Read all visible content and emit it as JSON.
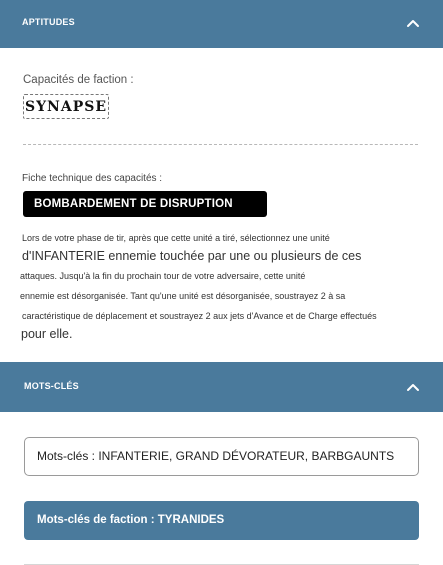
{
  "aptitudes": {
    "header": "APTITUDES",
    "faction_label": "Capacités de faction :",
    "faction_ability": "SYNAPSE",
    "tech_label": "Fiche technique des capacités :",
    "ability_name": "BOMBARDEMENT DE DISRUPTION",
    "ability_lines": [
      {
        "a": "Lors de votre phase de tir, après que cette unité a tiré, sélectionnez une unité",
        "b": ""
      },
      {
        "a": "",
        "b": "d'INFANTERIE ennemie touchée par une ou plusieurs de ces"
      },
      {
        "a": "attaques. Jusqu'à la fin du prochain tour de votre adversaire, cette unité",
        "b": ""
      },
      {
        "a": "ennemie est désorganisée. Tant qu'une unité est désorganisée, soustrayez 2 à sa",
        "b": ""
      },
      {
        "a": "caractéristique de déplacement et soustrayez 2 aux jets d'Avance et de Charge effectués",
        "b": ""
      },
      {
        "a": "",
        "b": "pour elle."
      }
    ]
  },
  "mots_cles": {
    "header": "MOTS-CLÉS",
    "keywords": "Mots-clés : INFANTERIE, GRAND DÉVORATEUR, BARBGAUNTS",
    "faction_keywords": "Mots-clés de faction : TYRANIDES"
  },
  "colors": {
    "header_bg": "#4a7a9c",
    "pill_bg": "#000000"
  },
  "icons": {
    "collapse": "chevron-up-icon"
  }
}
